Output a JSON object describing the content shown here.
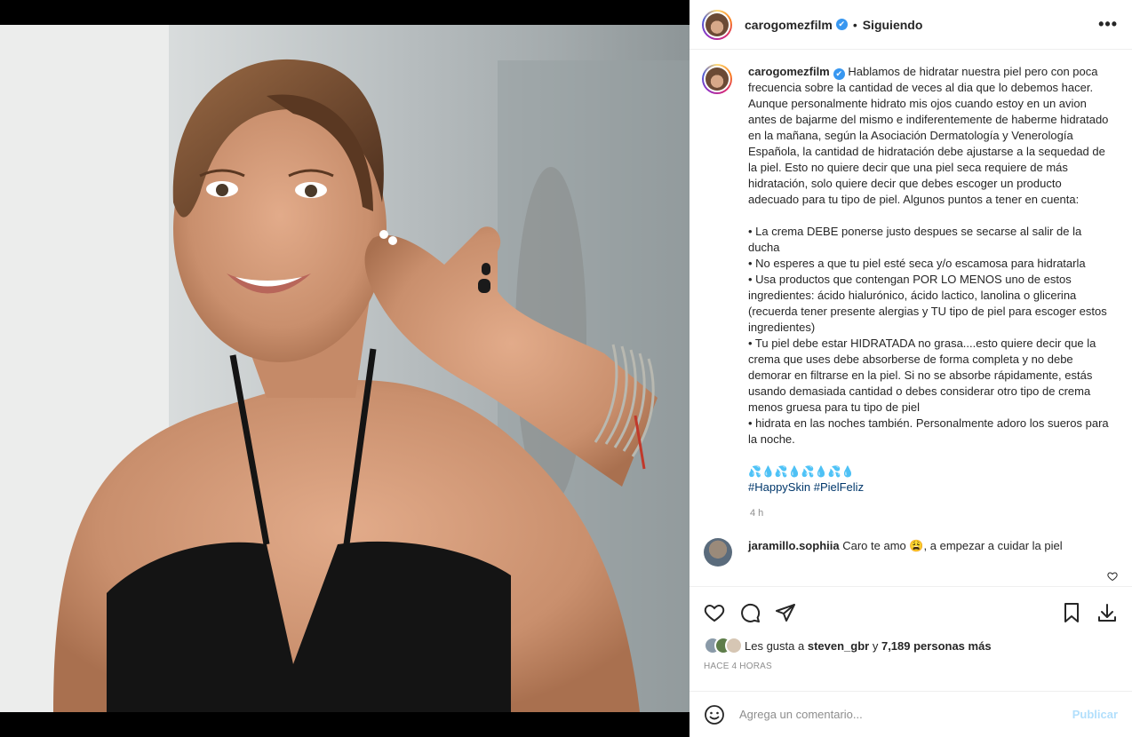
{
  "post": {
    "username": "carogomezfilm",
    "verified_mark": "✔",
    "separator": "•",
    "follow_status": "Siguiendo",
    "more_glyph": "•••"
  },
  "caption": {
    "username": "carogomezfilm",
    "text": "Hablamos de hidratar nuestra piel pero con poca frecuencia sobre la cantidad de veces al dia que lo debemos hacer. Aunque personalmente hidrato mis ojos cuando estoy en un avion antes de bajarme del mismo e indiferentemente de haberme hidratado en la mañana, según la Asociación Dermatología y Venerología Española, la cantidad de hidratación debe ajustarse a la sequedad de la piel. Esto no quiere decir que una piel seca requiere de más hidratación, solo quiere decir que debes escoger un producto adecuado para tu tipo de piel. Algunos puntos a tener en cuenta:\n\n• La crema DEBE ponerse justo despues se secarse al salir de la ducha\n• No esperes a que tu piel esté seca y/o escamosa para hidratarla\n• Usa productos que contengan POR LO MENOS uno de estos ingredientes: ácido hialurónico, ácido lactico, lanolina o glicerina (recuerda tener presente alergias y TU tipo de piel para escoger estos ingredientes)\n• Tu piel debe estar HIDRATADA no grasa....esto quiere decir que la crema que uses debe absorberse de forma completa y no debe demorar en filtrarse en la piel. Si no se absorbe rápidamente, estás usando demasiada cantidad o debes considerar otro tipo de crema menos gruesa para tu tipo de piel\n• hidrata en las noches también. Personalmente adoro los sueros para la noche.",
    "emojis": "💦💧💦💧💦💧💦💧",
    "hashtags": "#HappySkin #PielFeliz",
    "time": "4 h"
  },
  "comment": {
    "username": "jaramillo.sophiia",
    "text": "Caro te amo 😩, a empezar a cuidar la piel"
  },
  "likes": {
    "prefix": "Les gusta a",
    "user": "steven_gbr",
    "connector": "y",
    "others": "7,189 personas más"
  },
  "posted_ago": "HACE 4 HORAS",
  "add_comment": {
    "placeholder": "Agrega un comentario...",
    "publish_label": "Publicar"
  }
}
